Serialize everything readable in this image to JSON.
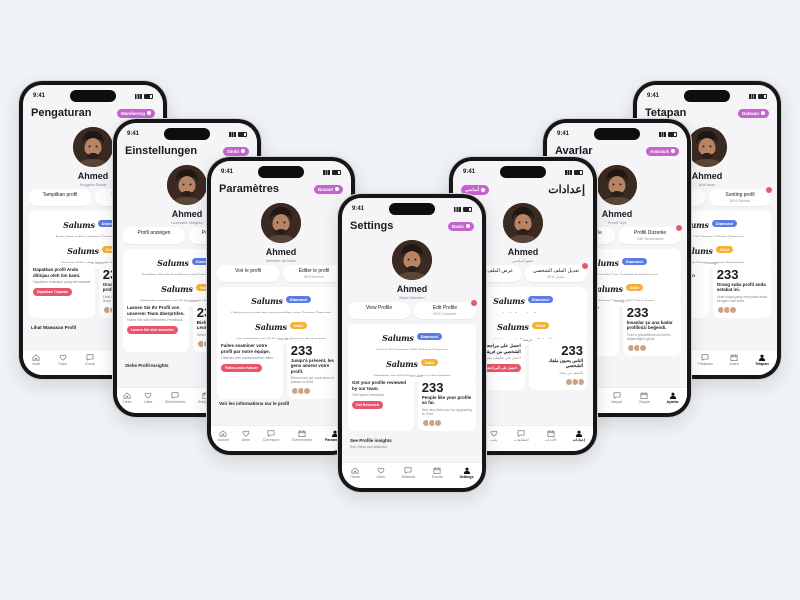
{
  "colors": {
    "background": "#f0f3f6",
    "accent_pill": "#c563cf",
    "diamond": "#5b7be6",
    "gold": "#f2b238",
    "cta": "#e8556a"
  },
  "brand": "Salums",
  "tier_diamond": "Diamond",
  "tier_gold": "Gold",
  "time": "9:41",
  "phones": {
    "id": {
      "title": "Pengaturan",
      "pill": "Mandiering",
      "name": "Ahmed",
      "role": "Anggota Dasar",
      "view": "Tampilkan profil",
      "edit": "Sunting profil",
      "edit_sub": "80% lengkap",
      "diamond_sub": "Buka Semua Fitur dengan Salams Diamond",
      "gold_sub": "Anggota 60% Lebih Mungkin Menikah",
      "review_title": "Dapatkan profil Anda ditinjau oleh tim kami.",
      "review_sub": "Dapatkan masukan yang bermanfaat",
      "review_btn": "Dapatkan Tinjauan",
      "likes_num": "233",
      "likes_text": "Orang yang menyukai profil Anda",
      "likes_sub": "Lihat siapa yang menyukai Anda",
      "insights": "Lihat Wawasan Profil",
      "insights_sub": "",
      "tabs": [
        "Awal",
        "Suka",
        "Cocok",
        "Acara",
        "Setelan"
      ]
    },
    "de": {
      "title": "Einstellungen",
      "pill": "Simbi",
      "name": "Ahmed",
      "role": "normales Mitglied",
      "view": "Profil anzeigen",
      "edit": "Profil bearbeiten",
      "edit_sub": "80% fertig",
      "diamond_sub": "Schalten Sie Alle Funktionen mit Salams Diamond frei",
      "gold_sub": "Mitglieder heiraten mit 60 % höherer Wahrscheinlichkeit",
      "review_title": "Lassen Sie Ihr Profil von unserem Team überprüfen.",
      "review_sub": "Holen Sie sich hilfreiches Feedback",
      "review_btn": "Lassen Sie sich bewerten",
      "likes_num": "233",
      "likes_text": "Bisher haben 233 Leute Ihr Profil gefallen",
      "likes_sub": "Sehen Sie, wem Sie gefallen",
      "insights": "Siehe Profil-Insights",
      "insights_sub": "",
      "tabs": [
        "Heim",
        "Likes",
        "Streichhölzer",
        "Ereignisse",
        "Einstellungen"
      ]
    },
    "fr": {
      "title": "Paramètres",
      "pill": "Basant",
      "name": "Ahmed",
      "role": "Membre de base",
      "view": "Voir le profil",
      "edit": "Éditer le profil",
      "edit_sub": "80% terminé",
      "diamond_sub": "Débloquez toutes les fonctionnalités avec Salams Diamond",
      "gold_sub": "Les membres ont 60 % plus de chances de se marier",
      "review_title": "Faites examiner votre profil par notre équipe.",
      "review_sub": "Obtenez des commentaires utiles",
      "review_btn": "Faites-vous évaluer",
      "likes_num": "233",
      "likes_text": "Jusqu'à présent, les gens aiment votre profil.",
      "likes_sub": "Découvrez qui vous aime et passez à Gold",
      "insights": "Voir les informations sur le profil",
      "insights_sub": "",
      "tabs": [
        "Accueil",
        "Aime",
        "Correspon",
        "Événements",
        "Paramètres"
      ]
    },
    "en": {
      "title": "Settings",
      "pill": "Basic",
      "name": "Ahmed",
      "role": "Basic Member",
      "view": "View Profile",
      "edit": "Edit Profile",
      "edit_sub": "80% Complete",
      "diamond_sub": "Unlock All Features With Salams Diamond",
      "gold_sub": "Members are 60% More Likely to Get Married",
      "review_title": "Get your profile reviewed by our team.",
      "review_sub": "Get helpful feedback",
      "review_btn": "Get Reviewed",
      "likes_num": "233",
      "likes_text": "People like your profile so far.",
      "likes_sub": "See who likes you by Upgrading to Gold",
      "insights": "See Profile insights",
      "insights_sub": "See views and statistics",
      "tabs": [
        "Home",
        "Likes",
        "Matches",
        "Events",
        "Settings"
      ]
    },
    "ar": {
      "title": "إعدادات",
      "pill": "أساسي",
      "name": "Ahmed",
      "role": "عضو أساسي",
      "view": "عرض الملف الشخصي",
      "edit": "تعديل الملف الشخصي",
      "edit_sub": "80% مكتمل",
      "diamond_sub": "فتح جميع الميزات مع السلام دايموند",
      "gold_sub": "الأعضاء أكثر عرضة للزواج بنسبة 60%",
      "review_title": "احصل على مراجعة ملفك الشخصي من فريقنا.",
      "review_sub": "احصل على تعليقات مفيدة",
      "review_btn": "احصل على المراجعة",
      "likes_num": "233",
      "likes_text": "الناس يحبون ملفك الشخصي",
      "likes_sub": "اكتشف من يحبك",
      "insights": "",
      "insights_sub": "",
      "tabs": [
        "الرئيسية",
        "يحب",
        "التطابقات",
        "الأحداث",
        "إعدادات"
      ]
    },
    "tr": {
      "title": "Avarlar",
      "pill": "Amiracık",
      "name": "Ahmed",
      "role": "Temel Üye",
      "view": "Profili Görüntüle",
      "edit": "Profili Düzenle",
      "edit_sub": "%80 Tamamlandı",
      "diamond_sub": "Salams Diamond ile Tüm Özelliklerin Kilidini Açın",
      "gold_sub": "Üyelerin Evlenme Olasılığı %60 Daha Fazla",
      "review_title": "Profilinizi ekibimize incelettirin.",
      "review_sub": "Faydalı geri bildirim alın",
      "review_btn": "İncelenin",
      "likes_num": "233",
      "likes_text": "İnsanlar şu ana kadar profilinizi beğendi.",
      "likes_sub": "Gold'a yükselterek sizi kimin beğendiğini görün",
      "insights": "",
      "insights_sub": "",
      "tabs": [
        "Ev",
        "Beğeniler",
        "Maçlar",
        "Olaylar",
        "Ayarlar"
      ]
    },
    "ms": {
      "title": "Tetapan",
      "pill": "Dakwan",
      "name": "Ahmed",
      "role": "Ahli Asas",
      "view": "Lihat Profil",
      "edit": "Sunting profil",
      "edit_sub": "80% Selesai",
      "diamond_sub": "Buka Semua Ciri Dengan Salams Diamond",
      "gold_sub": "Ahli 60% Lebih Berkemungkinan Berkahwin",
      "review_title": "Dapatkan profil anda disemak oleh pasukan kami.",
      "review_sub": "Dapatkan maklum balas",
      "review_btn": "Dapatkan Semakan",
      "likes_num": "233",
      "likes_text": "Orang suka profil anda setakat ini.",
      "likes_sub": "Lihat siapa yang menyukai anda dengan naik taraf",
      "insights": "",
      "insights_sub": "",
      "tabs": [
        "Rumah",
        "Suka",
        "Padanan",
        "Acara",
        "Tetapan"
      ]
    }
  }
}
